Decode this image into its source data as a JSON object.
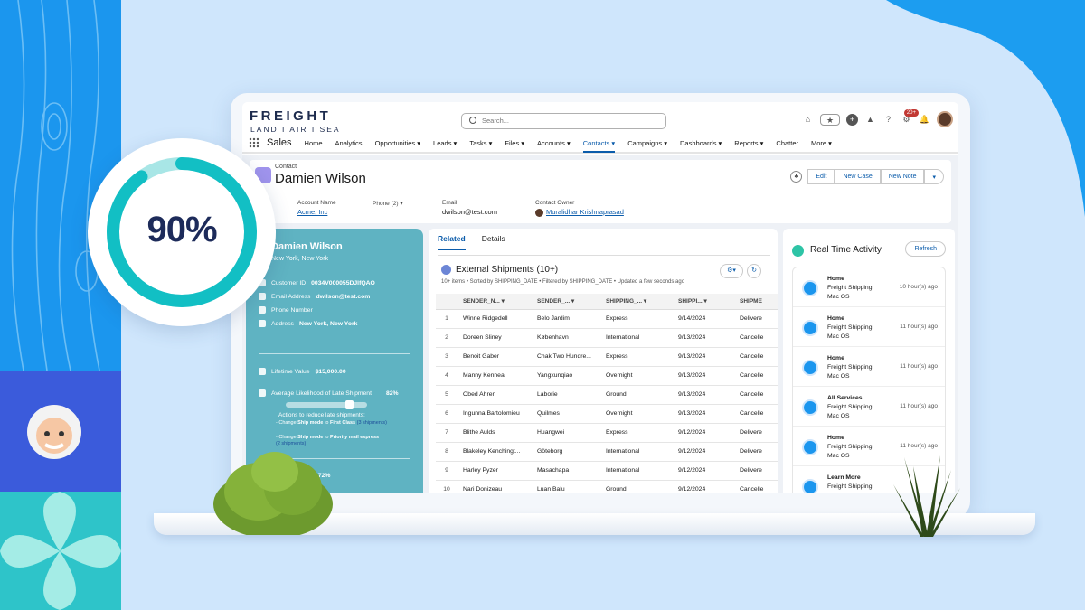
{
  "progress": {
    "value": 90,
    "label": "90%"
  },
  "brand": {
    "logo": "FREIGHT",
    "logo_sub": "LAND I AIR I SEA"
  },
  "search": {
    "placeholder": "Search..."
  },
  "header_icons": [
    "home-icon",
    "favorites-icon",
    "add-icon",
    "trailhead-icon",
    "help-icon",
    "setup-icon",
    "notifications-icon"
  ],
  "notifications_badge": "20+",
  "nav": {
    "app_name": "Sales",
    "items": [
      "Home",
      "Analytics",
      "Opportunities",
      "Leads",
      "Tasks",
      "Files",
      "Accounts",
      "Contacts",
      "Campaigns",
      "Dashboards",
      "Reports",
      "Chatter",
      "More"
    ],
    "active": "Contacts"
  },
  "record": {
    "type": "Contact",
    "name": "Damien Wilson",
    "buttons": [
      "Edit",
      "New Case",
      "New Note"
    ],
    "fields": [
      {
        "label": "Account Name",
        "value": "Acme, Inc"
      },
      {
        "label": "Phone (2)",
        "value": ""
      },
      {
        "label": "Email",
        "value": "dwilson@test.com"
      },
      {
        "label": "Contact Owner",
        "value": "Muralidhar Krishnaprasad"
      }
    ]
  },
  "profile": {
    "name": "Damien Wilson",
    "location": "New York, New York",
    "customer_id_label": "Customer ID",
    "customer_id": "0034V000055DJlfQAO",
    "email_label": "Email Address",
    "email": "dwilson@test.com",
    "phone_label": "Phone Number",
    "address_label": "Address",
    "address": "New York, New York",
    "ltv_label": "Lifetime Value",
    "ltv": "$15,000.00",
    "late_label": "Average Likelihood of Late Shipment",
    "late_value": "82%",
    "late_level": 0.82,
    "actions_title": "Actions to reduce late shipments:",
    "action_1a": "- Change",
    "action_1b": "Ship mode",
    "action_1c": "to",
    "action_1d": "First Class",
    "action_1e": "(3 shipments)",
    "action_2a": "- Change",
    "action_2b": "Ship mode",
    "action_2c": "to",
    "action_2d": "Priority mail express",
    "action_2e": "(2 shipments)",
    "bottom_label": "ure",
    "bottom_value": "72%"
  },
  "tabs": [
    "Related",
    "Details"
  ],
  "related_list": {
    "title": "External Shipments (10+)",
    "subtitle": "10+ items • Sorted by SHIPPING_DATE • Filtered by SHIPPING_DATE • Updated a few seconds ago",
    "columns": [
      "SENDER_N...",
      "SENDER_...",
      "SHIPPING_...",
      "SHIPPI...",
      "SHIPME"
    ],
    "rows": [
      [
        "1",
        "Winne Ridgedell",
        "Belo Jardim",
        "Express",
        "9/14/2024",
        "Delivere"
      ],
      [
        "2",
        "Doreen Sliney",
        "København",
        "International",
        "9/13/2024",
        "Cancelle"
      ],
      [
        "3",
        "Benoit Gaber",
        "Chak Two Hundre...",
        "Express",
        "9/13/2024",
        "Cancelle"
      ],
      [
        "4",
        "Manny Kennea",
        "Yangxunqiao",
        "Overnight",
        "9/13/2024",
        "Cancelle"
      ],
      [
        "5",
        "Obed Ahren",
        "Laborie",
        "Ground",
        "9/13/2024",
        "Cancelle"
      ],
      [
        "6",
        "Ingunna Bartolomieu",
        "Quilmes",
        "Overnight",
        "9/13/2024",
        "Cancelle"
      ],
      [
        "7",
        "Blithe Aulds",
        "Huangwei",
        "Express",
        "9/12/2024",
        "Delivere"
      ],
      [
        "8",
        "Blakeley Kenchingt...",
        "Göteborg",
        "International",
        "9/12/2024",
        "Delivere"
      ],
      [
        "9",
        "Harley Pyzer",
        "Masachapa",
        "International",
        "9/12/2024",
        "Delivere"
      ],
      [
        "10",
        "Nari Donizeau",
        "Luan Balu",
        "Ground",
        "9/12/2024",
        "Cancelle"
      ]
    ]
  },
  "activity": {
    "title": "Real Time Activity",
    "refresh": "Refresh",
    "items": [
      {
        "title": "Home",
        "line1": "Freight Shipping",
        "line2": "Mac OS",
        "time": "10 hour(s) ago"
      },
      {
        "title": "Home",
        "line1": "Freight Shipping",
        "line2": "Mac OS",
        "time": "11 hour(s) ago"
      },
      {
        "title": "Home",
        "line1": "Freight Shipping",
        "line2": "Mac OS",
        "time": "11 hour(s) ago"
      },
      {
        "title": "All Services",
        "line1": "Freight Shipping",
        "line2": "Mac OS",
        "time": "11 hour(s) ago"
      },
      {
        "title": "Home",
        "line1": "Freight Shipping",
        "line2": "Mac OS",
        "time": "11 hour(s) ago"
      },
      {
        "title": "Learn More",
        "line1": "Freight Shipping",
        "line2": "",
        "time": ""
      }
    ]
  },
  "colors": {
    "accent": "#0b5cab",
    "teal_card": "#5fb3c2",
    "ring": "#12bfc4",
    "ring_track": "#a8e6e6",
    "background": "#cfe6fc"
  }
}
